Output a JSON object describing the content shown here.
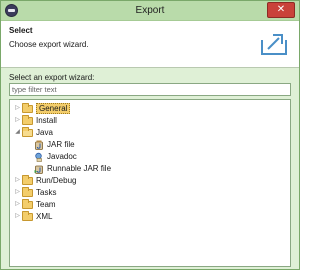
{
  "window": {
    "title": "Export",
    "close_symbol": "✕"
  },
  "header": {
    "title": "Select",
    "description": "Choose export wizard."
  },
  "wizard": {
    "label": "Select an export wizard:",
    "filter_placeholder": "type filter text",
    "tree": [
      {
        "label": "General",
        "expanded": false,
        "selected": true,
        "icon": "folder-icon"
      },
      {
        "label": "Install",
        "expanded": false,
        "icon": "folder-icon"
      },
      {
        "label": "Java",
        "expanded": true,
        "icon": "folder-open-icon",
        "children": [
          {
            "label": "JAR file",
            "icon": "jar-file-icon"
          },
          {
            "label": "Javadoc",
            "icon": "javadoc-icon"
          },
          {
            "label": "Runnable JAR file",
            "icon": "runnable-jar-icon"
          }
        ]
      },
      {
        "label": "Run/Debug",
        "expanded": false,
        "icon": "folder-icon"
      },
      {
        "label": "Tasks",
        "expanded": false,
        "icon": "folder-icon"
      },
      {
        "label": "Team",
        "expanded": false,
        "icon": "folder-icon"
      },
      {
        "label": "XML",
        "expanded": false,
        "icon": "folder-icon"
      }
    ]
  },
  "colors": {
    "titlebar": "#b9dbaa",
    "body": "#dff0d6",
    "folder": "#f3cd6b",
    "close": "#c9423a"
  }
}
